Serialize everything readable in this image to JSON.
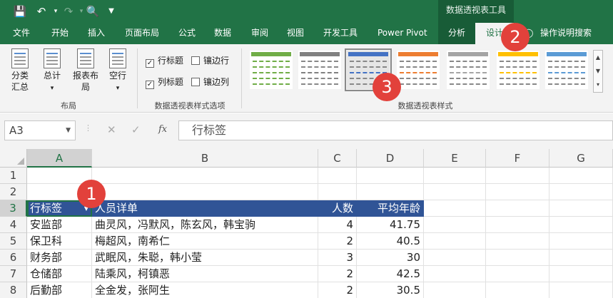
{
  "title_bar": {
    "context_title": "数据透视表工具"
  },
  "tabs": [
    {
      "label": "文件"
    },
    {
      "label": "开始"
    },
    {
      "label": "插入"
    },
    {
      "label": "页面布局"
    },
    {
      "label": "公式"
    },
    {
      "label": "数据"
    },
    {
      "label": "审阅"
    },
    {
      "label": "视图"
    },
    {
      "label": "开发工具"
    },
    {
      "label": "Power Pivot"
    },
    {
      "label": "分析"
    },
    {
      "label": "设计"
    },
    {
      "label": "操作说明搜索"
    }
  ],
  "ribbon": {
    "layout_buttons": [
      {
        "label": "分类汇总"
      },
      {
        "label": "总计"
      },
      {
        "label": "报表布局"
      },
      {
        "label": "空行"
      }
    ],
    "layout_group_label": "布局",
    "options": [
      {
        "label": "行标题",
        "checked": true
      },
      {
        "label": "镶边行",
        "checked": false
      },
      {
        "label": "列标题",
        "checked": true
      },
      {
        "label": "镶边列",
        "checked": false
      }
    ],
    "options_group_label": "数据透视表样式选项",
    "styles_group_label": "数据透视表样式",
    "style_colors": [
      "#70ad47",
      "#808080",
      "#4472c4",
      "#ed7d31",
      "#a5a5a5",
      "#ffc000",
      "#5b9bd5"
    ]
  },
  "formula_bar": {
    "name_box": "A3",
    "formula": "行标签",
    "fx": "fx"
  },
  "sheet": {
    "columns": [
      "A",
      "B",
      "C",
      "D",
      "E",
      "F",
      "G"
    ],
    "rows": [
      "1",
      "2",
      "3",
      "4",
      "5",
      "6",
      "7",
      "8"
    ],
    "header": [
      "行标签",
      "人员详单",
      "人数",
      "平均年龄"
    ],
    "data": [
      {
        "dept": "安监部",
        "people": "曲灵风，冯默风，陈玄风，韩宝驹",
        "count": "4",
        "age": "41.75"
      },
      {
        "dept": "保卫科",
        "people": "梅超风，南希仁",
        "count": "2",
        "age": "40.5"
      },
      {
        "dept": "财务部",
        "people": "武眠风，朱聪，韩小莹",
        "count": "3",
        "age": "30"
      },
      {
        "dept": "仓储部",
        "people": "陆乘风，柯镇恶",
        "count": "2",
        "age": "42.5"
      },
      {
        "dept": "后勤部",
        "people": "全金发，张阿生",
        "count": "2",
        "age": "30.5"
      }
    ]
  },
  "callouts": [
    "1",
    "2",
    "3"
  ],
  "accent": "#217346",
  "pivot_header_color": "#305496",
  "callout_color": "#e2413b"
}
